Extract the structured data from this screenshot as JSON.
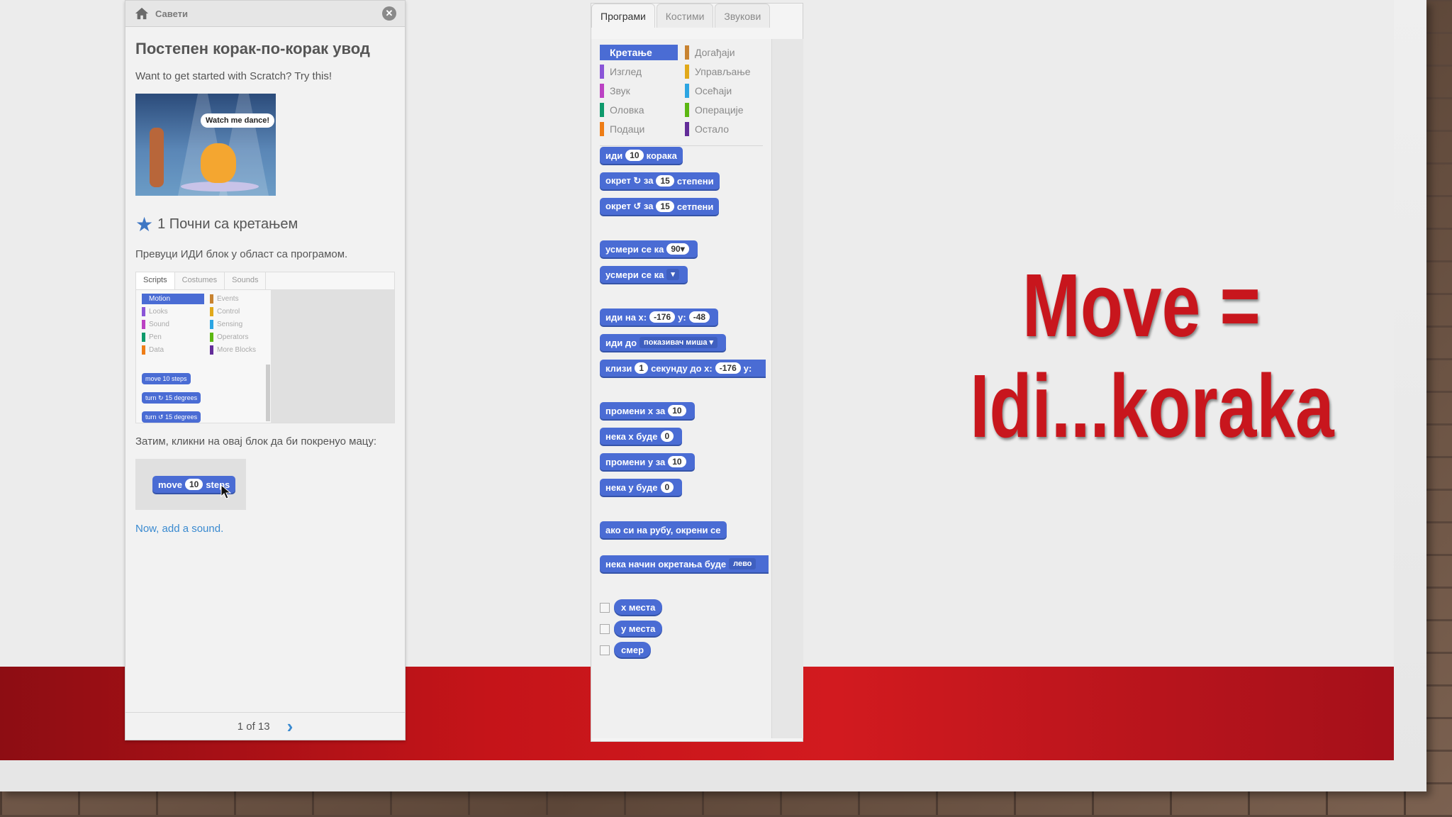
{
  "slide": {
    "title_line1": "Move =",
    "title_line2": "Idi...koraka",
    "accent_color": "#c8161d"
  },
  "tips": {
    "header_label": "Савети",
    "home_icon": "home-icon",
    "close_icon": "close-icon",
    "heading": "Постепен корак-по-корак увод",
    "intro": "Want to get started with Scratch? Try this!",
    "image_bubble": "Watch me dance!",
    "step_number": "1",
    "step_title": "Почни са кретањем",
    "step_instruction": "Превуци ИДИ блок у област са програмом.",
    "mini_tabs": [
      "Scripts",
      "Costumes",
      "Sounds"
    ],
    "mini_categories": [
      "Motion",
      "Events",
      "Looks",
      "Control",
      "Sound",
      "Sensing",
      "Pen",
      "Operators",
      "Data",
      "More Blocks"
    ],
    "mini_blocks": [
      "move 10 steps",
      "turn ↻ 15 degrees",
      "turn ↺ 15 degrees"
    ],
    "step_instruction2": "Затим, кликни на овај блок да би покренуо мацу:",
    "demo_block": {
      "pre": "move",
      "value": "10",
      "post": "steps"
    },
    "next_link": "Now, add a sound.",
    "pager": "1 of 13"
  },
  "scripts": {
    "tabs": [
      "Програми",
      "Костими",
      "Звукови"
    ],
    "categories": [
      {
        "label": "Кретање",
        "color": "#4a6cd4"
      },
      {
        "label": "Догађаји",
        "color": "#c88330"
      },
      {
        "label": "Изглед",
        "color": "#8a55d7"
      },
      {
        "label": "Управљање",
        "color": "#e1a91a"
      },
      {
        "label": "Звук",
        "color": "#bb42c3"
      },
      {
        "label": "Осећаји",
        "color": "#2ca5e2"
      },
      {
        "label": "Оловка",
        "color": "#0e9a6c"
      },
      {
        "label": "Операције",
        "color": "#5cb712"
      },
      {
        "label": "Подаци",
        "color": "#ee7d16"
      },
      {
        "label": "Остало",
        "color": "#632d99"
      }
    ],
    "blocks": {
      "b1": {
        "pre": "иди",
        "v1": "10",
        "post": "корака"
      },
      "b2": {
        "pre": "окрет ↻ за",
        "v1": "15",
        "post": "степени"
      },
      "b3": {
        "pre": "окрет ↺ за",
        "v1": "15",
        "post": "сетпени"
      },
      "b4": {
        "pre": "усмери се ка",
        "v1": "90▾"
      },
      "b5": {
        "pre": "усмери се ка",
        "v1": "▾"
      },
      "b6": {
        "pre": "иди на x:",
        "v1": "-176",
        "mid": "y:",
        "v2": "-48"
      },
      "b7": {
        "pre": "иди до",
        "v1": "показивач миша ▾"
      },
      "b8": {
        "pre": "клизи",
        "v1": "1",
        "mid": "секунду до x:",
        "v2": "-176",
        "post": "y:"
      },
      "b9": {
        "pre": "промени x за",
        "v1": "10"
      },
      "b10": {
        "pre": "нека x буде",
        "v1": "0"
      },
      "b11": {
        "pre": "промени y за",
        "v1": "10"
      },
      "b12": {
        "pre": "нека y буде",
        "v1": "0"
      },
      "b13": {
        "pre": "ако си на рубу, окрени се"
      },
      "b14": {
        "pre": "нека начин окретања буде",
        "v1": "лево"
      },
      "r1": "x места",
      "r2": "y места",
      "r3": "смер"
    }
  }
}
